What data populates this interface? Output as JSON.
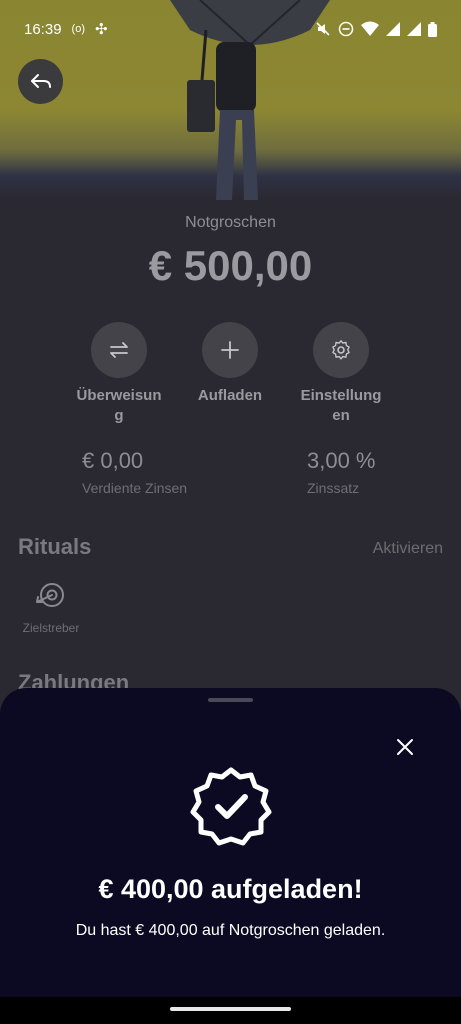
{
  "status_bar": {
    "time": "16:39"
  },
  "account": {
    "name": "Notgroschen",
    "balance": "€ 500,00"
  },
  "actions": [
    {
      "label": "Überweisung",
      "icon": "transfer-arrows-icon"
    },
    {
      "label": "Aufladen",
      "icon": "plus-icon"
    },
    {
      "label": "Einstellungen",
      "icon": "gear-icon"
    }
  ],
  "stats": {
    "interest_earned": {
      "value": "€ 0,00",
      "caption": "Verdiente Zinsen"
    },
    "interest_rate": {
      "value": "3,00 %",
      "caption": "Zinssatz"
    }
  },
  "rituals": {
    "title": "Rituals",
    "link": "Aktivieren",
    "items": [
      {
        "label": "Zielstreber",
        "icon": "target-arrow-icon"
      }
    ]
  },
  "payments": {
    "title": "Zahlungen"
  },
  "sheet": {
    "title": "€ 400,00 aufgeladen!",
    "message": "Du hast € 400,00 auf Notgroschen geladen."
  },
  "colors": {
    "sheet_background": "#0c0a22",
    "hero_yellow": "#8d8734",
    "screen_background": "#2a2830"
  }
}
